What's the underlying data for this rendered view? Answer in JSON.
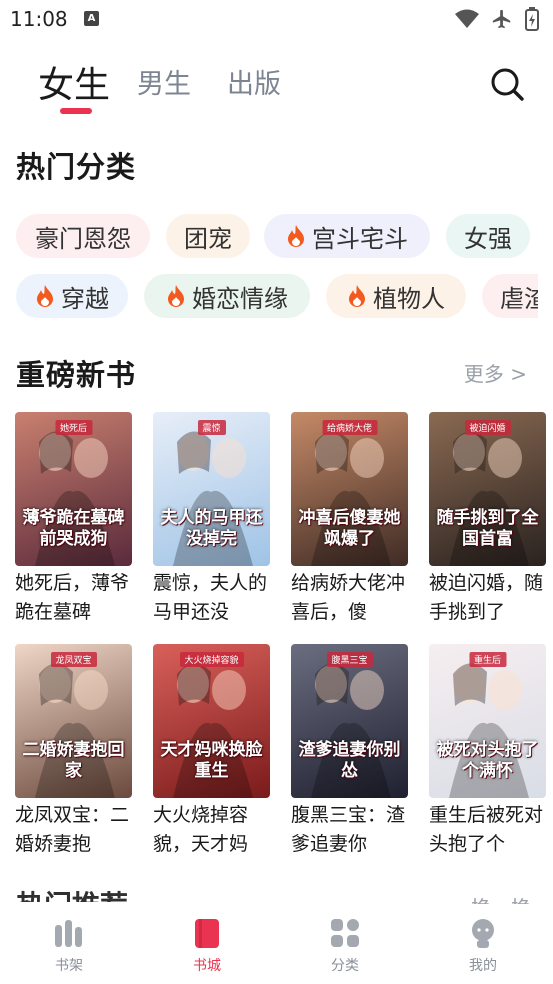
{
  "status": {
    "time": "11:08"
  },
  "tabs": {
    "female": "女生",
    "male": "男生",
    "publish": "出版"
  },
  "hot_categories": {
    "title": "热门分类",
    "row1": [
      {
        "label": "豪门恩怨",
        "hot": false,
        "bg": "#fdeef0"
      },
      {
        "label": "团宠",
        "hot": false,
        "bg": "#fdf2e8"
      },
      {
        "label": "宫斗宅斗",
        "hot": true,
        "bg": "#eff0fb"
      },
      {
        "label": "女强",
        "hot": false,
        "bg": "#e9f6f4"
      }
    ],
    "row2": [
      {
        "label": "穿越",
        "hot": true,
        "bg": "#ecf3fc"
      },
      {
        "label": "婚恋情缘",
        "hot": true,
        "bg": "#eaf5ef"
      },
      {
        "label": "植物人",
        "hot": true,
        "bg": "#fdf2e8"
      },
      {
        "label": "虐渣",
        "hot": false,
        "bg": "#fdeef0"
      }
    ]
  },
  "new_books": {
    "title": "重磅新书",
    "more": "更多 >",
    "books": [
      {
        "name": "她死后，薄爷跪在墓碑",
        "cover_tag": "她死后",
        "cover_title": "薄爷跪在墓碑前哭成狗",
        "bg1": "#5a2a3c",
        "bg2": "#c9806f"
      },
      {
        "name": "震惊，夫人的马甲还没",
        "cover_tag": "震惊",
        "cover_title": "夫人的马甲还没掉完",
        "bg1": "#9fc3e6",
        "bg2": "#e7eef8"
      },
      {
        "name": "给病娇大佬冲喜后，傻",
        "cover_tag": "给病娇大佬",
        "cover_title": "冲喜后傻妻她飒爆了",
        "bg1": "#3f2b25",
        "bg2": "#c58a67"
      },
      {
        "name": "被迫闪婚，随手挑到了",
        "cover_tag": "被迫闪婚",
        "cover_title": "随手挑到了全国首富",
        "bg1": "#2a2220",
        "bg2": "#8a6a52"
      },
      {
        "name": "龙凤双宝：二婚娇妻抱",
        "cover_tag": "龙凤双宝",
        "cover_title": "二婚娇妻抱回家",
        "bg1": "#6b4a3d",
        "bg2": "#efd6c7"
      },
      {
        "name": "大火烧掉容貌，天才妈",
        "cover_tag": "大火烧掉容貌",
        "cover_title": "天才妈咪换脸重生",
        "bg1": "#7a1b1b",
        "bg2": "#d9605a"
      },
      {
        "name": "腹黑三宝：渣爹追妻你",
        "cover_tag": "腹黑三宝",
        "cover_title": "渣爹追妻你别怂",
        "bg1": "#1f2030",
        "bg2": "#6b6e80"
      },
      {
        "name": "重生后被死对头抱了个",
        "cover_tag": "重生后",
        "cover_title": "被死对头抱了个满怀",
        "bg1": "#d9dde6",
        "bg2": "#f6eef0"
      }
    ]
  },
  "recommend": {
    "title": "热门推荐",
    "more": "换一换"
  },
  "bottom_nav": {
    "shelf": "书架",
    "store": "书城",
    "category": "分类",
    "mine": "我的"
  },
  "colors": {
    "accent": "#ea3350",
    "flame": "#f25a1f",
    "muted": "#8a8f98"
  },
  "icons": [
    "search-icon",
    "flame-icon",
    "bookshelf-icon",
    "bookstore-icon",
    "category-icon",
    "profile-icon",
    "wifi-icon",
    "airplane-icon",
    "battery-icon"
  ]
}
